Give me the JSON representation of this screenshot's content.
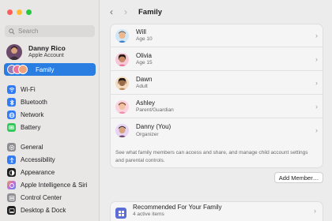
{
  "window": {
    "title": "Family"
  },
  "sidebar": {
    "search_placeholder": "Search",
    "account": {
      "name": "Danny Rico",
      "subtitle": "Apple Account"
    },
    "selected": {
      "label": "Family"
    },
    "items": [
      {
        "label": "Wi-Fi",
        "icon": "wifi-icon",
        "color": "#2f7cf6"
      },
      {
        "label": "Bluetooth",
        "icon": "bluetooth-icon",
        "color": "#2f7cf6"
      },
      {
        "label": "Network",
        "icon": "globe-icon",
        "color": "#2f7cf6"
      },
      {
        "label": "Battery",
        "icon": "battery-icon",
        "color": "#34c759"
      },
      {
        "label": "General",
        "icon": "gear-icon",
        "color": "#8e8e93"
      },
      {
        "label": "Accessibility",
        "icon": "accessibility-icon",
        "color": "#2f7cf6"
      },
      {
        "label": "Appearance",
        "icon": "appearance-icon",
        "color": "#1d1d1f"
      },
      {
        "label": "Apple Intelligence & Siri",
        "icon": "siri-icon",
        "color": "#c36bd9"
      },
      {
        "label": "Control Center",
        "icon": "control-center-icon",
        "color": "#8e8e93"
      },
      {
        "label": "Desktop & Dock",
        "icon": "dock-icon",
        "color": "#1d1d1f"
      }
    ]
  },
  "main": {
    "members": [
      {
        "name": "Will",
        "role": "Age 10",
        "color": "#f0a27a"
      },
      {
        "name": "Olivia",
        "role": "Age 15",
        "color": "#e8749a"
      },
      {
        "name": "Dawn",
        "role": "Adult",
        "color": "#b98a5b"
      },
      {
        "name": "Ashley",
        "role": "Parent/Guardian",
        "color": "#f4b8c8"
      },
      {
        "name": "Danny (You)",
        "role": "Organizer",
        "color": "#9a7ab8"
      }
    ],
    "description": "See what family members can access and share, and manage child account settings and parental controls.",
    "add_button": "Add Member…",
    "recommended": {
      "title": "Recommended For Your Family",
      "subtitle": "4 active items"
    }
  }
}
